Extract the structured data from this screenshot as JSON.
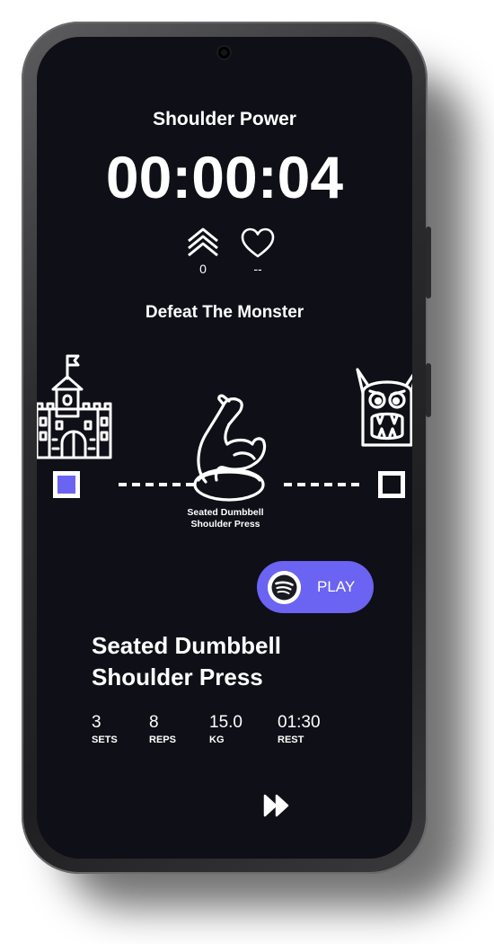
{
  "workout": {
    "title": "Shoulder Power",
    "timer": "00:00:04"
  },
  "stats": {
    "level_icon": "chevrons-up-icon",
    "level_value": "0",
    "heart_icon": "heart-icon",
    "heart_value": "--"
  },
  "challenge": {
    "title": "Defeat The Monster",
    "start_icon": "castle-icon",
    "end_icon": "monster-icon",
    "exercise_icon": "flexed-arm-icon",
    "exercise_caption_line1": "Seated Dumbbell",
    "exercise_caption_line2": "Shoulder Press",
    "progress_color": "#6b63f2"
  },
  "music": {
    "icon": "spotify-icon",
    "label": "PLAY",
    "color": "#6b63f2"
  },
  "exercise": {
    "name_line1": "Seated Dumbbell",
    "name_line2": "Shoulder Press",
    "metrics": [
      {
        "value": "3",
        "label": "SETS"
      },
      {
        "value": "8",
        "label": "REPS"
      },
      {
        "value": "15.0",
        "label": "KG"
      },
      {
        "value": "01:30",
        "label": "REST"
      }
    ]
  },
  "controls": {
    "skip_icon": "fast-forward-icon"
  },
  "theme": {
    "background": "#0f0f17",
    "text": "#ffffff"
  }
}
